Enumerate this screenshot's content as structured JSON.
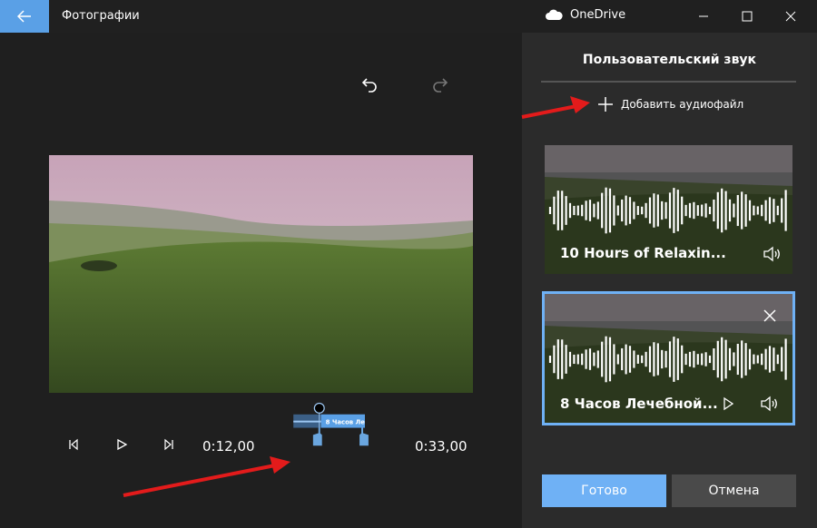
{
  "titlebar": {
    "app_title": "Фотографии",
    "onedrive_label": "OneDrive"
  },
  "editor": {
    "time_start": "0:12,00",
    "time_end": "0:33,00",
    "clip_label": "8 Часов Ле"
  },
  "panel": {
    "title": "Пользовательский звук",
    "add_audio": "Добавить аудиофайл",
    "tracks": [
      {
        "label": "10 Hours of Relaxin..."
      },
      {
        "label": "8 Часов Лечебной..."
      }
    ],
    "done_label": "Готово",
    "cancel_label": "Отмена"
  },
  "colors": {
    "accent": "#6fb1f5",
    "back_button": "#5aa0e6",
    "annotation_arrow": "#e31b1b"
  }
}
